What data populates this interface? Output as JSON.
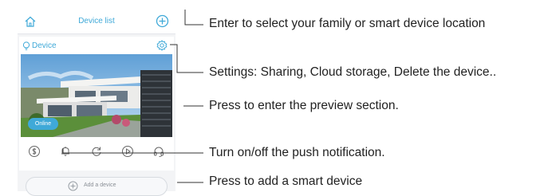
{
  "app": {
    "title": "Device list",
    "device_name": "Device",
    "status_badge": "Online",
    "add_device_label": "Add a device"
  },
  "callouts": [
    "Enter to select your family or smart device location",
    "Settings: Sharing, Cloud storage, Delete the device..",
    "Press to enter the preview section.",
    "Turn on/off the push notification.",
    "Press to add a smart device"
  ],
  "icons": {
    "home": "home-icon",
    "add": "plus-circle-icon",
    "device": "bulb-icon",
    "settings": "gear-icon",
    "actions": [
      "dollar-circle-icon",
      "bell-icon",
      "refresh-icon",
      "play-circle-icon",
      "headset-icon"
    ]
  },
  "colors": {
    "accent": "#3fa9d8",
    "line": "#333333",
    "sky": "#8fc3e8",
    "grass": "#5b8f3a"
  }
}
